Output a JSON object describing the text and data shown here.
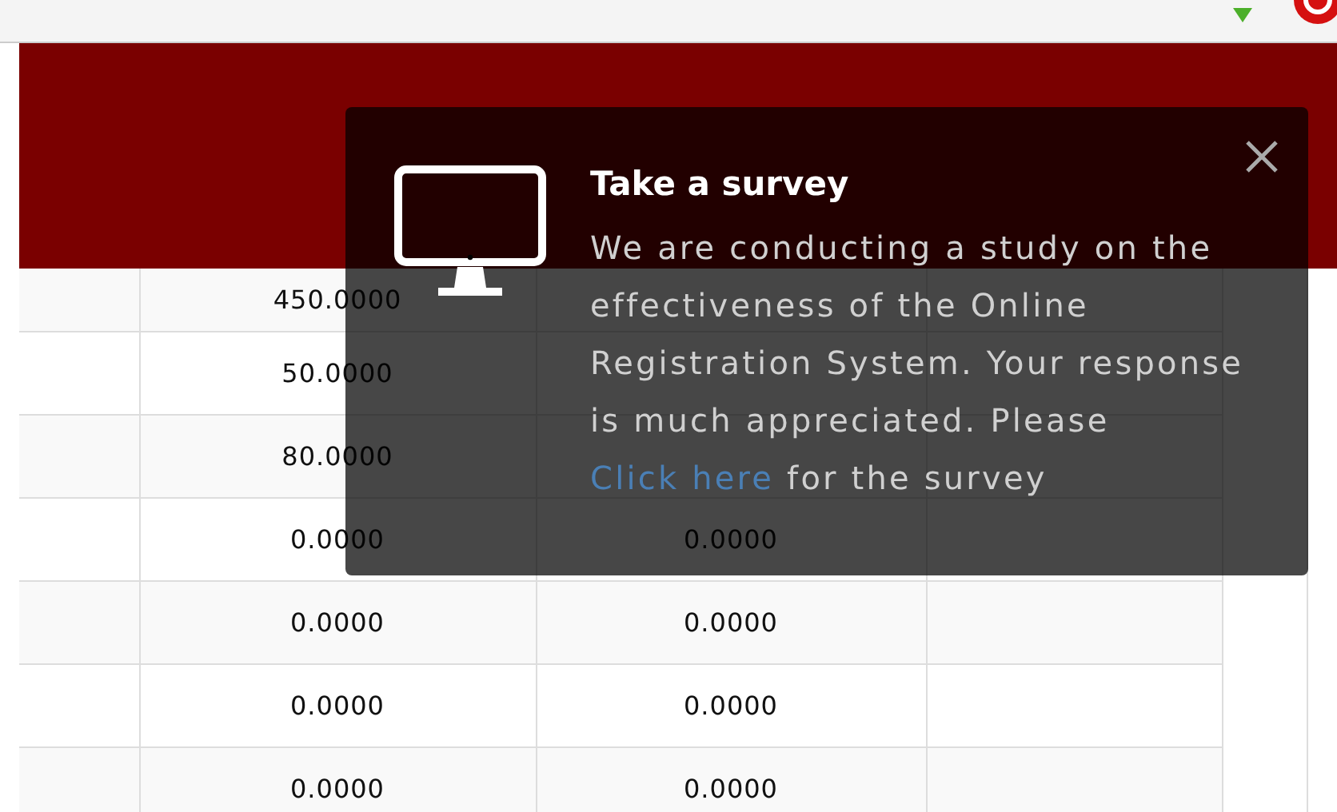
{
  "table": {
    "rows": [
      {
        "column_2": "450.0000"
      },
      {
        "column_2": "50.0000"
      },
      {
        "column_2": "80.0000"
      },
      {
        "column_2": "0.0000",
        "column_3": "0.0000"
      },
      {
        "column_2": "0.0000",
        "column_3": "0.0000"
      },
      {
        "column_2": "0.0000",
        "column_3": "0.0000"
      },
      {
        "column_2": "0.0000",
        "column_3": "0.0000"
      }
    ]
  },
  "survey_popup": {
    "title": "Take a survey",
    "message": "We are conducting a study on the effectiveness of the Online Registration System. Your response is much appreciated. Please ",
    "link": "Click here",
    "message_end": " for the survey"
  }
}
